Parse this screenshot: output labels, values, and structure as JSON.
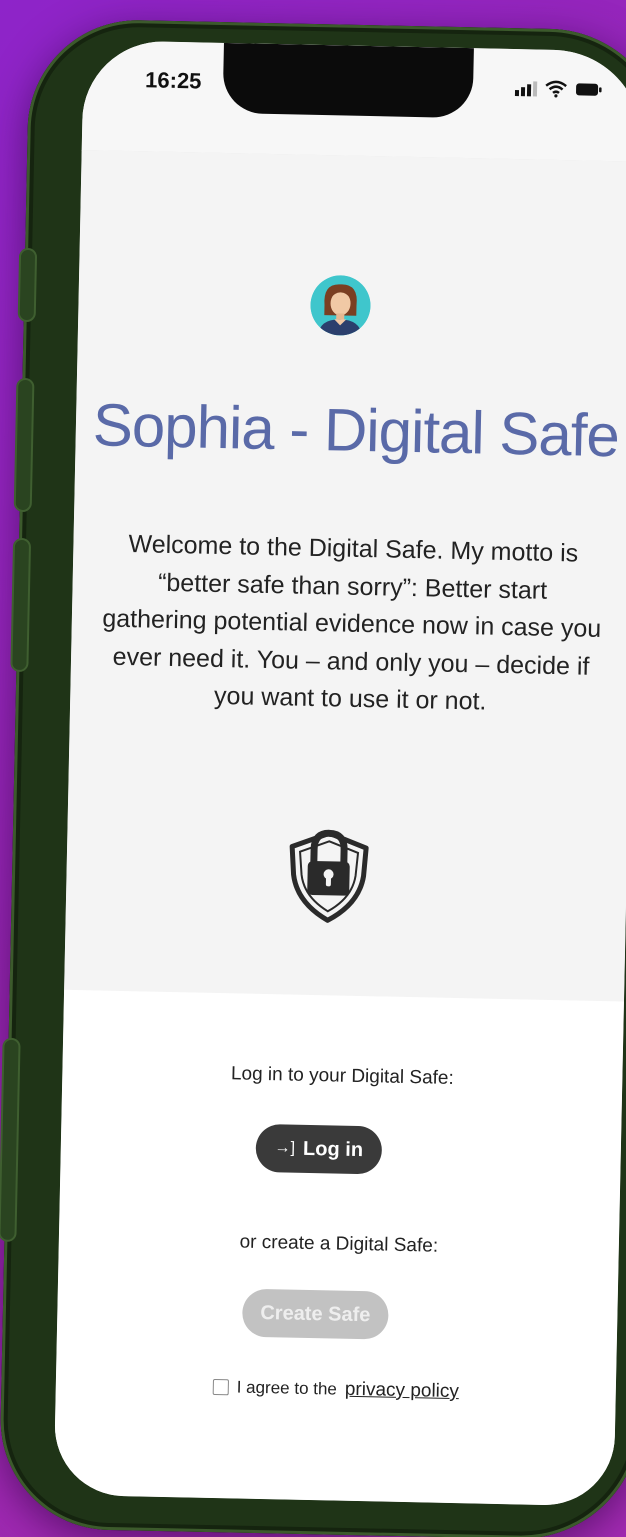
{
  "status_bar": {
    "time": "16:25"
  },
  "header": {
    "title": "Sophia - Digital Safe"
  },
  "intro": {
    "text": "Welcome to the Digital Safe. My motto is “better safe than sorry”: Better start gathering potential evidence now in case you ever need it. You – and only you – decide if you want to use it or not."
  },
  "login": {
    "label": "Log in to your Digital Safe:",
    "button_icon": "→]",
    "button_label": "Log in"
  },
  "create": {
    "label": "or create a Digital Safe:",
    "button_label": "Create Safe"
  },
  "agreement": {
    "checked": false,
    "prefix": "I agree to the",
    "link_label": "privacy policy"
  },
  "icons": {
    "avatar": "avatar-woman-icon",
    "lock": "shield-lock-icon",
    "login": "login-arrow-icon",
    "signal": "signal-icon",
    "wifi": "wifi-icon",
    "battery": "battery-icon"
  },
  "colors": {
    "background": "#9c27b0",
    "phone_frame": "#1f3417",
    "title": "#5a6aa8",
    "avatar_bg": "#3fc6cc",
    "login_button": "#3a3a3a",
    "create_button_disabled": "#c2c2c2"
  }
}
